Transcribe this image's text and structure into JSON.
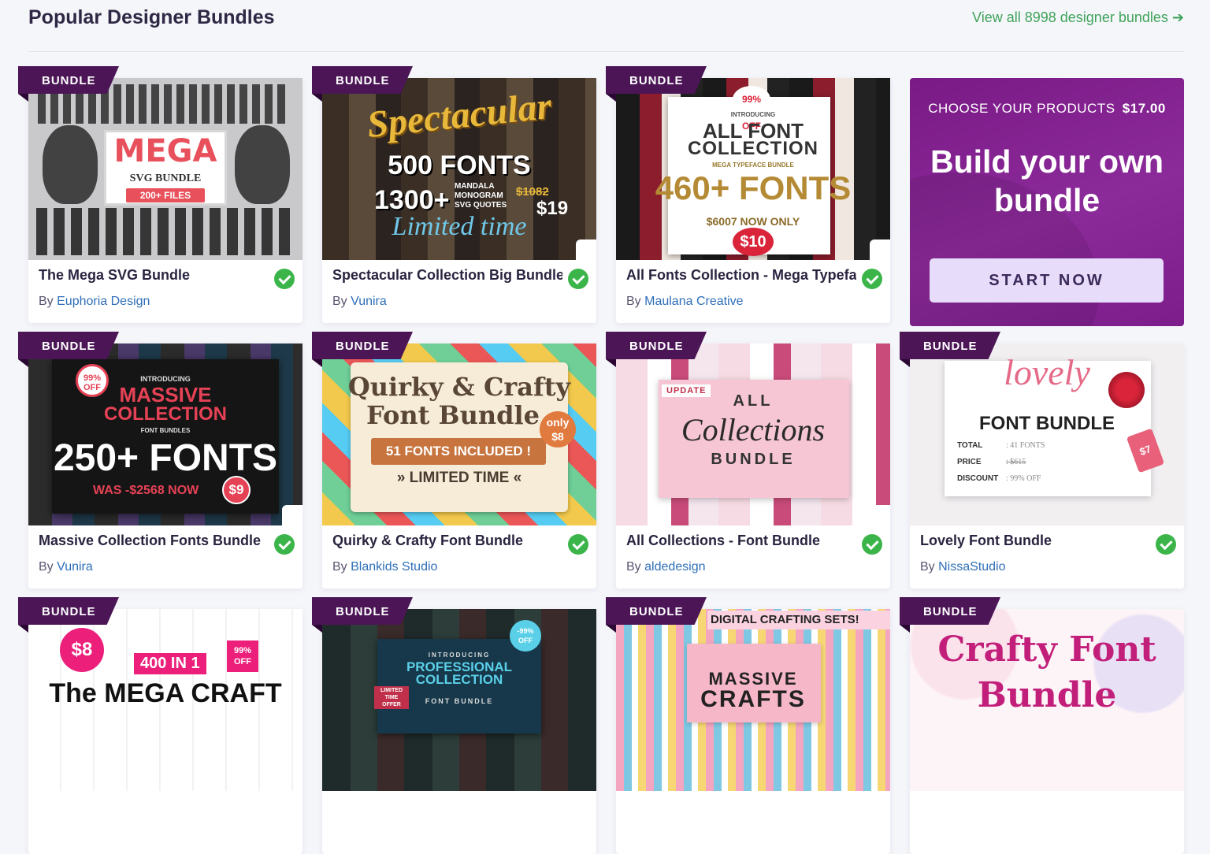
{
  "header": {
    "title": "Popular Designer Bundles",
    "view_all": "View all 8998 designer bundles",
    "view_all_arrow": "➔"
  },
  "badge_label": "BUNDLE",
  "by_label": "By",
  "cards": [
    {
      "title": "The Mega SVG Bundle",
      "author": "Euphoria Design",
      "thumb": {
        "l1": "MEGA",
        "l2": "SVG BUNDLE",
        "l3": "200+ FILES"
      }
    },
    {
      "title": "Spectacular Collection Big Bundle",
      "author": "Vunira",
      "thumb": {
        "l1": "Spectacular",
        "l2": "500 FONTS",
        "l3": "1300+",
        "l4": "MANDALA MONOGRAM SVG QUOTES",
        "l5": "$1082",
        "l6": "$19",
        "l7": "Limited time"
      }
    },
    {
      "title": "All Fonts Collection - Mega Typeface Bundle",
      "author": "Maulana Creative",
      "thumb": {
        "l1": "99% OFF",
        "l2": "INTRODUCING",
        "l3": "ALL FONT",
        "l4": "COLLECTION",
        "l5": "MEGA TYPEFACE BUNDLE",
        "l6": "460+ FONTS",
        "l7": "$6007 NOW ONLY",
        "l8": "$10"
      }
    },
    {
      "title": "Massive Collection Fonts Bundle",
      "author": "Vunira",
      "thumb": {
        "l1": "99% OFF",
        "l2": "INTRODUCING",
        "l3": "MASSIVE",
        "l4": "COLLECTION",
        "l5": "FONT BUNDLES",
        "l6": "250+ FONTS",
        "l7": "WAS -$2568 NOW",
        "l8": "$9"
      }
    },
    {
      "title": "Quirky & Crafty Font Bundle",
      "author": "Blankids Studio",
      "thumb": {
        "l1": "Quirky & Crafty",
        "l2": "Font Bundle",
        "l3": "51 FONTS INCLUDED !",
        "l4": "» LIMITED TIME «",
        "l5": "only $8"
      }
    },
    {
      "title": "All Collections - Font Bundle",
      "author": "aldedesign",
      "thumb": {
        "l1": "UPDATE",
        "l2": "ALL",
        "l3": "Collections",
        "l4": "BUNDLE"
      }
    },
    {
      "title": "Lovely Font Bundle",
      "author": "NissaStudio",
      "thumb": {
        "l1": "lovely",
        "l2": "FONT BUNDLE",
        "l3": "TOTAL",
        "l4": ": 41 FONTS",
        "l5": "PRICE",
        "l6": ": $615",
        "l7": "DISCOUNT",
        "l8": ": 99% OFF",
        "l9": "$7"
      }
    },
    {
      "title": "",
      "author": "",
      "thumb": {
        "l1": "$8",
        "l2": "400 IN 1",
        "l3": "99% OFF",
        "l4": "The MEGA CRAFT"
      }
    },
    {
      "title": "",
      "author": "",
      "thumb": {
        "l1": "INTRODUCING",
        "l2": "PROFESSIONAL",
        "l3": "COLLECTION",
        "l4": "FONT BUNDLE",
        "l5": "LIMITED TIME OFFER",
        "l6": "-99% OFF"
      }
    },
    {
      "title": "",
      "author": "",
      "thumb": {
        "l1": "DIGITAL CRAFTING SETS!",
        "l2": "MASSIVE",
        "l3": "CRAFTS"
      }
    },
    {
      "title": "",
      "author": "",
      "thumb": {
        "l1": "Crafty Font",
        "l2": "Bundle"
      }
    }
  ],
  "promo": {
    "choose": "CHOOSE YOUR PRODUCTS",
    "price": "$17.00",
    "headline": "Build your own bundle",
    "button": "START NOW"
  },
  "colors": {
    "badge": "#4b1556",
    "link": "#2f6fb8",
    "view_all": "#3fa35a",
    "check": "#3bb54a",
    "promo_bg": "#86259a",
    "promo_button": "#e7dcfa"
  }
}
